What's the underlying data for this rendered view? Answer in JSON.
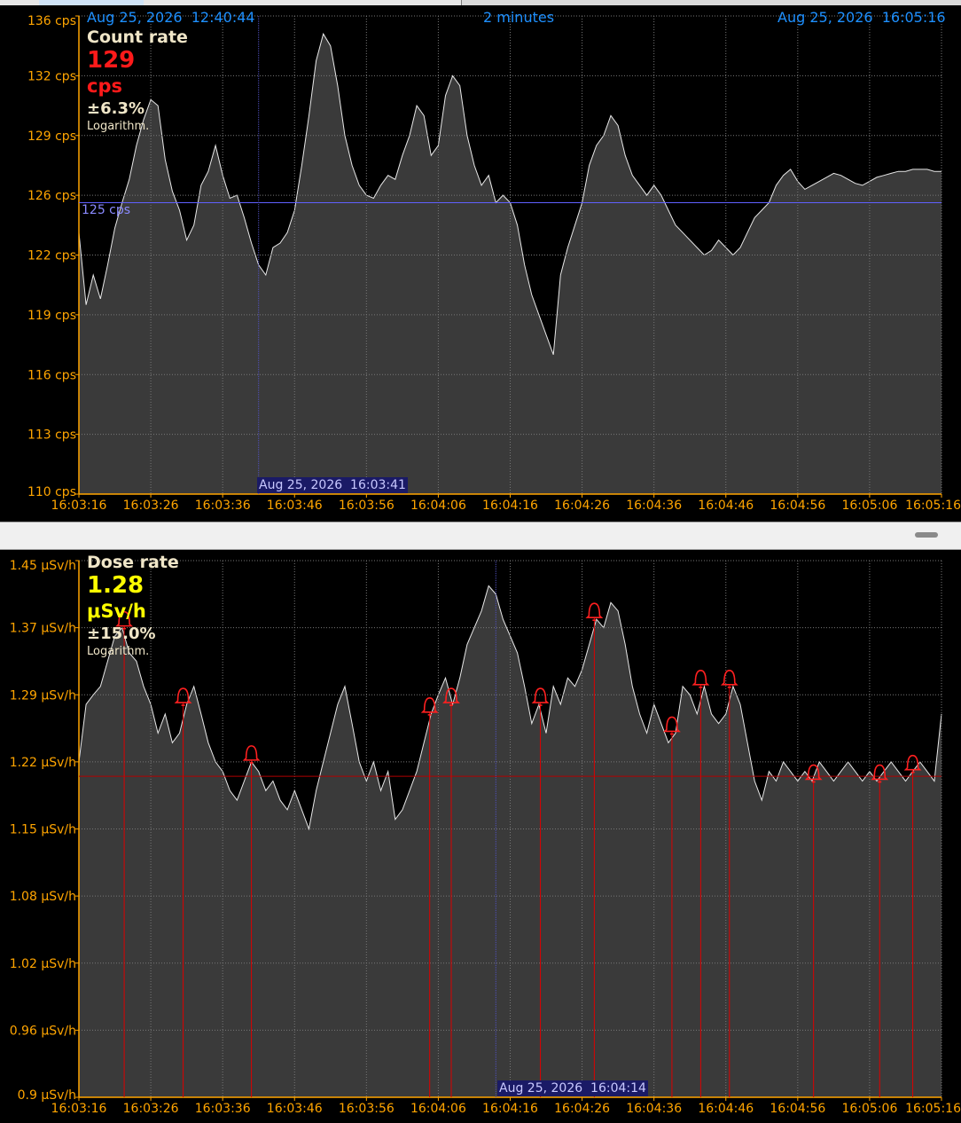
{
  "count_panel": {
    "header": {
      "start_time": "Aug 25, 2026  12:40:44",
      "span": "2 minutes",
      "end_time": "Aug 25, 2026  16:05:16"
    },
    "readout": {
      "title": "Count rate",
      "value": "129",
      "unit": "cps",
      "uncertainty": "±6.3%",
      "mode": "Logarithm."
    },
    "reference_label": "125 cps",
    "reference_value": 125.5,
    "cursor_label": "Aug 25, 2026  16:03:41",
    "cursor_time_s": 25,
    "colors": {
      "value": "#ff1a1a",
      "axis": "#ffa500",
      "header": "#1e90ff",
      "reference": "#7070ff"
    }
  },
  "dose_panel": {
    "readout": {
      "title": "Dose rate",
      "value": "1.28",
      "unit": "μSv/h",
      "uncertainty": "±15.0%",
      "mode": "Logarithm."
    },
    "cursor_label": "Aug 25, 2026  16:04:14",
    "cursor_time_s": 58,
    "threshold_value": 1.205,
    "colors": {
      "value": "#ffff00",
      "axis": "#ffa500",
      "alarm": "#dd0000"
    }
  },
  "chart_data": [
    {
      "type": "area",
      "title": "Count rate",
      "x_unit": "seconds since 16:03:16",
      "xlim": [
        0,
        120
      ],
      "x_ticks": [
        0,
        10,
        20,
        30,
        40,
        50,
        60,
        70,
        80,
        90,
        100,
        110,
        120
      ],
      "x_tick_labels": [
        "16:03:16",
        "16:03:26",
        "16:03:36",
        "16:03:46",
        "16:03:56",
        "16:04:06",
        "16:04:16",
        "16:04:26",
        "16:04:36",
        "16:04:46",
        "16:04:56",
        "16:05:06",
        "16:05:16"
      ],
      "ylim": [
        110,
        136
      ],
      "y_ticks": [
        110,
        113,
        116,
        119,
        122,
        126,
        129,
        132,
        136
      ],
      "y_tick_labels": [
        "110 cps",
        "113 cps",
        "116 cps",
        "119 cps",
        "122 cps",
        "126 cps",
        "129 cps",
        "132 cps",
        "136 cps"
      ],
      "grid": true,
      "series": [
        {
          "x": [
            0,
            1,
            2,
            3,
            4,
            5,
            6,
            7,
            8,
            9,
            10,
            11,
            12,
            13,
            14,
            15,
            16,
            17,
            18,
            19,
            20,
            21,
            22,
            23,
            24,
            25,
            26,
            27,
            28,
            29,
            30,
            31,
            32,
            33,
            34,
            35,
            36,
            37,
            38,
            39,
            40,
            41,
            42,
            43,
            44,
            45,
            46,
            47,
            48,
            49,
            50,
            51,
            52,
            53,
            54,
            55,
            56,
            57,
            58,
            59,
            60,
            61,
            62,
            63,
            64,
            65,
            66,
            67,
            68,
            69,
            70,
            71,
            72,
            73,
            74,
            75,
            76,
            77,
            78,
            79,
            80,
            81,
            82,
            83,
            84,
            85,
            86,
            87,
            88,
            89,
            90,
            91,
            92,
            93,
            94,
            95,
            96,
            97,
            98,
            99,
            100,
            101,
            102,
            103,
            104,
            105,
            106,
            107,
            108,
            109,
            110,
            111,
            112,
            113,
            114,
            115,
            116,
            117,
            118,
            119,
            120
          ],
          "y": [
            123.5,
            119.5,
            121,
            119.8,
            121.5,
            123.8,
            125.5,
            126.8,
            128.5,
            129.8,
            130.8,
            130.5,
            127.8,
            126.2,
            125,
            123,
            124,
            126.5,
            127.2,
            128.5,
            127,
            125.8,
            126,
            124.5,
            122.8,
            121.5,
            121,
            122.5,
            122.8,
            123.5,
            125,
            127.5,
            130,
            133,
            134.8,
            134,
            131.5,
            129,
            127.5,
            126.5,
            126,
            125.8,
            126.5,
            127,
            126.8,
            128,
            129,
            130.5,
            130,
            128,
            128.5,
            131,
            132,
            131.5,
            129,
            127.5,
            126.5,
            127,
            125.5,
            126,
            125.5,
            124,
            121.5,
            120,
            119,
            118,
            117,
            121,
            122.5,
            124,
            125.5,
            127.5,
            128.5,
            129,
            130,
            129.5,
            128,
            127,
            126.5,
            126,
            126.5,
            126,
            125,
            124,
            123.5,
            123,
            122.5,
            122,
            122.3,
            123,
            122.5,
            122,
            122.5,
            123.5,
            124.5,
            125,
            125.5,
            126.5,
            127,
            127.3,
            126.7,
            126.3,
            126.5,
            126.7,
            126.9,
            127.1,
            127.0,
            126.8,
            126.6,
            126.5,
            126.7,
            126.9,
            127.0,
            127.1,
            127.2,
            127.2,
            127.3,
            127.3,
            127.3,
            127.2,
            127.2
          ]
        }
      ]
    },
    {
      "type": "area",
      "title": "Dose rate",
      "x_unit": "seconds since 16:03:16",
      "xlim": [
        0,
        120
      ],
      "x_ticks": [
        0,
        10,
        20,
        30,
        40,
        50,
        60,
        70,
        80,
        90,
        100,
        110,
        120
      ],
      "x_tick_labels": [
        "16:03:16",
        "16:03:26",
        "16:03:36",
        "16:03:46",
        "16:03:56",
        "16:04:06",
        "16:04:16",
        "16:04:26",
        "16:04:36",
        "16:04:46",
        "16:04:56",
        "16:05:06",
        "16:05:16"
      ],
      "ylim": [
        0.9,
        1.45
      ],
      "y_ticks": [
        0.9,
        0.96,
        1.02,
        1.08,
        1.15,
        1.22,
        1.29,
        1.37,
        1.45
      ],
      "y_tick_labels": [
        "0.9 μSv/h",
        "0.96 μSv/h",
        "1.02 μSv/h",
        "1.08 μSv/h",
        "1.15 μSv/h",
        "1.22 μSv/h",
        "1.29 μSv/h",
        "1.37 μSv/h",
        "1.45 μSv/h"
      ],
      "grid": true,
      "series": [
        {
          "x": [
            0,
            1,
            2,
            3,
            4,
            5,
            6,
            7,
            8,
            9,
            10,
            11,
            12,
            13,
            14,
            15,
            16,
            17,
            18,
            19,
            20,
            21,
            22,
            23,
            24,
            25,
            26,
            27,
            28,
            29,
            30,
            31,
            32,
            33,
            34,
            35,
            36,
            37,
            38,
            39,
            40,
            41,
            42,
            43,
            44,
            45,
            46,
            47,
            48,
            49,
            50,
            51,
            52,
            53,
            54,
            55,
            56,
            57,
            58,
            59,
            60,
            61,
            62,
            63,
            64,
            65,
            66,
            67,
            68,
            69,
            70,
            71,
            72,
            73,
            74,
            75,
            76,
            77,
            78,
            79,
            80,
            81,
            82,
            83,
            84,
            85,
            86,
            87,
            88,
            89,
            90,
            91,
            92,
            93,
            94,
            95,
            96,
            97,
            98,
            99,
            100,
            101,
            102,
            103,
            104,
            105,
            106,
            107,
            108,
            109,
            110,
            111,
            112,
            113,
            114,
            115,
            116,
            117,
            118,
            119,
            120
          ],
          "y": [
            1.22,
            1.28,
            1.29,
            1.3,
            1.33,
            1.36,
            1.37,
            1.34,
            1.33,
            1.3,
            1.28,
            1.25,
            1.27,
            1.24,
            1.25,
            1.28,
            1.3,
            1.27,
            1.24,
            1.22,
            1.21,
            1.19,
            1.18,
            1.2,
            1.22,
            1.21,
            1.19,
            1.2,
            1.18,
            1.17,
            1.19,
            1.17,
            1.15,
            1.19,
            1.22,
            1.25,
            1.28,
            1.3,
            1.26,
            1.22,
            1.2,
            1.22,
            1.19,
            1.21,
            1.16,
            1.17,
            1.19,
            1.21,
            1.24,
            1.27,
            1.29,
            1.31,
            1.28,
            1.31,
            1.35,
            1.37,
            1.39,
            1.42,
            1.41,
            1.38,
            1.36,
            1.34,
            1.3,
            1.26,
            1.28,
            1.25,
            1.3,
            1.28,
            1.31,
            1.3,
            1.32,
            1.35,
            1.38,
            1.37,
            1.4,
            1.39,
            1.35,
            1.3,
            1.27,
            1.25,
            1.28,
            1.26,
            1.24,
            1.25,
            1.3,
            1.29,
            1.27,
            1.3,
            1.27,
            1.26,
            1.27,
            1.3,
            1.28,
            1.24,
            1.2,
            1.18,
            1.21,
            1.2,
            1.22,
            1.21,
            1.2,
            1.21,
            1.2,
            1.22,
            1.21,
            1.2,
            1.21,
            1.22,
            1.21,
            1.2,
            1.21,
            1.2,
            1.21,
            1.22,
            1.21,
            1.2,
            1.21,
            1.22,
            1.21,
            1.2,
            1.27
          ]
        }
      ],
      "alarm_markers_x": [
        6.3,
        14.5,
        24,
        48.8,
        51.8,
        64.2,
        71.7,
        82.5,
        86.5,
        90.5,
        102.2,
        111.4,
        116
      ]
    }
  ]
}
